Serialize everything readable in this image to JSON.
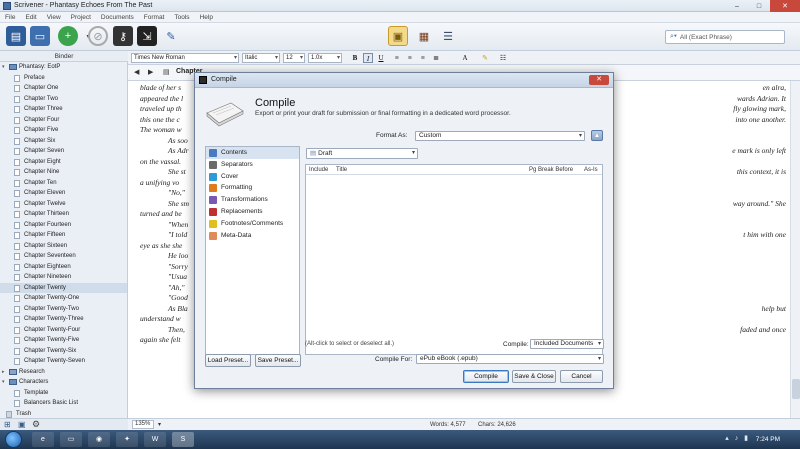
{
  "window": {
    "title": "Scrivener - Phantasy Echoes From The Past",
    "controls": [
      "–",
      "□",
      "✕"
    ]
  },
  "menu": [
    "File",
    "Edit",
    "View",
    "Project",
    "Documents",
    "Format",
    "Tools",
    "Help"
  ],
  "toolbar": {
    "search_placeholder": "All (Exact Phrase)"
  },
  "binder": {
    "header": "Binder",
    "root": "Phantasy: EotP",
    "items": [
      "Preface",
      "Chapter One",
      "Chapter Two",
      "Chapter Three",
      "Chapter Four",
      "Chapter Five",
      "Chapter Six",
      "Chapter Seven",
      "Chapter Eight",
      "Chapter Nine",
      "Chapter Ten",
      "Chapter Eleven",
      "Chapter Twelve",
      "Chapter Thirteen",
      "Chapter Fourteen",
      "Chapter Fifteen",
      "Chapter Sixteen",
      "Chapter Seventeen",
      "Chapter Eighteen",
      "Chapter Nineteen",
      "Chapter Twenty",
      "Chapter Twenty-One",
      "Chapter Twenty-Two",
      "Chapter Twenty-Three",
      "Chapter Twenty-Four",
      "Chapter Twenty-Five",
      "Chapter Twenty-Six",
      "Chapter Twenty-Seven"
    ],
    "selected_item": "Chapter Twenty",
    "research": "Research",
    "characters": "Characters",
    "character_items": [
      "Template",
      "Balancers Basic List"
    ],
    "trash": "Trash"
  },
  "formatbar": {
    "font": "Times New Roman",
    "style": "Italic",
    "size": "12",
    "spacing": "1.0x",
    "bold": "B",
    "italic": "I",
    "underline": "U"
  },
  "editor": {
    "chapter_title": "Chapter",
    "left_lines": [
      "blade of her s",
      "appeared the l",
      "traveled up th",
      "this one the c",
      "The woman w",
      "As soo",
      "As Adr",
      "on the vassal.",
      "She st",
      "a unifying vo",
      "\"No,\"",
      "She sm",
      "turned and be",
      "\"When",
      "\"I told",
      "eye as she she",
      "He loo",
      "\"Sorry",
      "\"Usua",
      "\"Ah,\"",
      "\"Good",
      "As Bla",
      "understand w",
      "Then,",
      "again she felt"
    ],
    "right_lines": [
      "en alra,",
      "wards Adrian. It",
      "fly glowing mark,",
      "into one another.",
      "",
      "",
      "e mark is only left",
      "",
      "this context, it is",
      "",
      "",
      "way around.\" She",
      "",
      "",
      "t him with one",
      "",
      "",
      "",
      "",
      "",
      "",
      "help but",
      "",
      "faded and once",
      ""
    ]
  },
  "status": {
    "zoom": "135%",
    "words": "Words: 4,577",
    "chars": "Chars: 24,626"
  },
  "taskbar": {
    "clock": "7:24 PM"
  },
  "compile_dialog": {
    "title": "Compile",
    "heading": "Compile",
    "subtitle": "Export or print your draft for submission or final formatting in a dedicated word processor.",
    "format_as_label": "Format As:",
    "format_as_value": "Custom",
    "sidebar": [
      "Contents",
      "Separators",
      "Cover",
      "Formatting",
      "Transformations",
      "Replacements",
      "Footnotes/Comments",
      "Meta-Data"
    ],
    "draft_selector": "Draft",
    "columns": [
      "Include",
      "Title",
      "Pg Break Before",
      "As-Is"
    ],
    "hint": "(Alt-click to select or deselect all.)",
    "compile_label": "Compile:",
    "compile_value": "Included Documents",
    "compile_for_label": "Compile For:",
    "compile_for_value": "ePub eBook (.epub)",
    "buttons": {
      "load_preset": "Load Preset...",
      "save_preset": "Save Preset...",
      "compile": "Compile",
      "save_close": "Save & Close",
      "cancel": "Cancel"
    }
  }
}
